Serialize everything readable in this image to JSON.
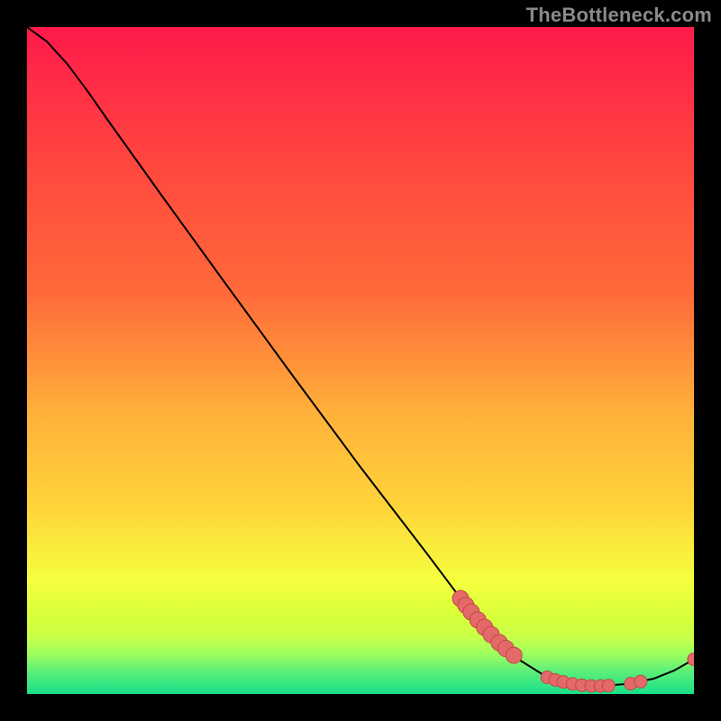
{
  "watermark": "TheBottleneck.com",
  "chart_data": {
    "type": "line",
    "title": "",
    "xlabel": "",
    "ylabel": "",
    "xlim": [
      0,
      100
    ],
    "ylim": [
      0,
      100
    ],
    "background_gradient": {
      "top": "#ff1a4b",
      "mid_upper": "#ff6a3a",
      "mid": "#ffd43a",
      "mid_lower": "#d7ff3a",
      "band": "#9dff60",
      "bottom": "#18e08a"
    },
    "curve": [
      {
        "x": 0.0,
        "y": 100.0
      },
      {
        "x": 3.0,
        "y": 97.8
      },
      {
        "x": 6.0,
        "y": 94.5
      },
      {
        "x": 9.0,
        "y": 90.5
      },
      {
        "x": 12.0,
        "y": 86.2
      },
      {
        "x": 20.0,
        "y": 75.0
      },
      {
        "x": 30.0,
        "y": 61.2
      },
      {
        "x": 40.0,
        "y": 47.5
      },
      {
        "x": 50.0,
        "y": 34.0
      },
      {
        "x": 60.0,
        "y": 21.0
      },
      {
        "x": 66.0,
        "y": 13.0
      },
      {
        "x": 70.0,
        "y": 8.5
      },
      {
        "x": 74.0,
        "y": 5.0
      },
      {
        "x": 78.0,
        "y": 2.5
      },
      {
        "x": 82.0,
        "y": 1.4
      },
      {
        "x": 86.0,
        "y": 1.2
      },
      {
        "x": 90.0,
        "y": 1.5
      },
      {
        "x": 94.0,
        "y": 2.3
      },
      {
        "x": 97.0,
        "y": 3.5
      },
      {
        "x": 100.0,
        "y": 5.2
      }
    ],
    "markers_descending": [
      {
        "x": 65.0,
        "y": 14.3
      },
      {
        "x": 65.8,
        "y": 13.3
      },
      {
        "x": 66.6,
        "y": 12.3
      },
      {
        "x": 67.6,
        "y": 11.1
      },
      {
        "x": 68.6,
        "y": 10.0
      },
      {
        "x": 69.6,
        "y": 8.9
      },
      {
        "x": 70.8,
        "y": 7.7
      },
      {
        "x": 71.8,
        "y": 6.8
      },
      {
        "x": 73.0,
        "y": 5.8
      }
    ],
    "markers_bottom": [
      {
        "x": 78.0,
        "y": 2.5
      },
      {
        "x": 79.2,
        "y": 2.1
      },
      {
        "x": 80.4,
        "y": 1.8
      },
      {
        "x": 81.8,
        "y": 1.5
      },
      {
        "x": 83.2,
        "y": 1.3
      },
      {
        "x": 84.6,
        "y": 1.2
      },
      {
        "x": 86.0,
        "y": 1.2
      },
      {
        "x": 87.2,
        "y": 1.25
      },
      {
        "x": 90.5,
        "y": 1.55
      },
      {
        "x": 92.0,
        "y": 1.85
      }
    ],
    "marker_end": {
      "x": 100.0,
      "y": 5.2
    },
    "marker_style": {
      "fill": "#e46a6a",
      "stroke": "#c24848",
      "radius_small": 7,
      "radius_large": 9
    },
    "curve_style": {
      "stroke": "#000000",
      "width": 2
    }
  }
}
